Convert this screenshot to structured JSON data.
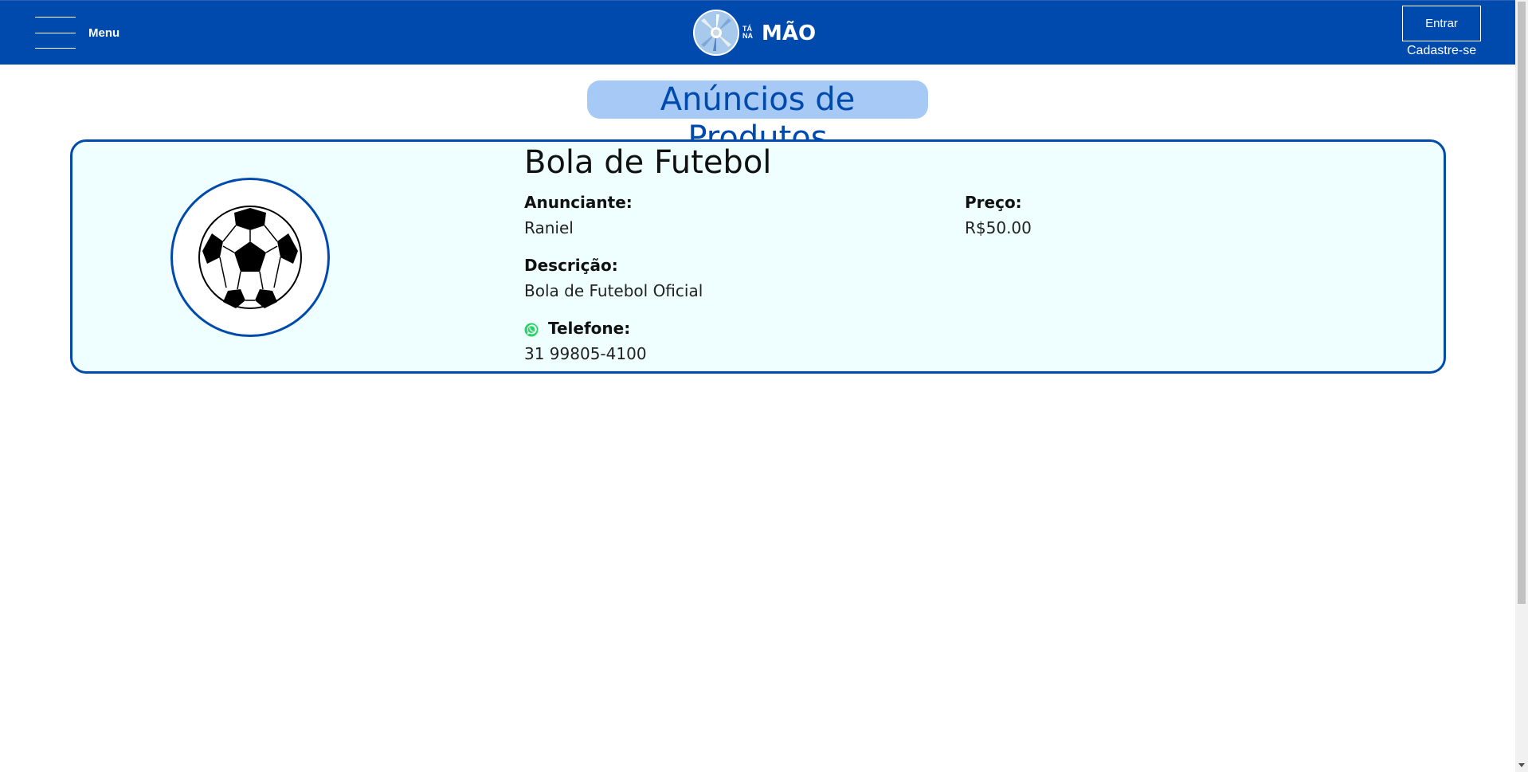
{
  "header": {
    "menu_label": "Menu",
    "logo": {
      "small_top": "TÁ",
      "small_bottom": "NA",
      "big": "MÃO"
    },
    "login_button": "Entrar",
    "signup_link": "Cadastre-se"
  },
  "main": {
    "title": "Anúncios de Produtos",
    "product": {
      "name": "Bola de Futebol",
      "advertiser_label": "Anunciante:",
      "advertiser": "Raniel",
      "price_label": "Preço:",
      "price": "R$50.00",
      "description_label": "Descrição:",
      "description": "Bola de Futebol Oficial",
      "phone_label": "Telefone:",
      "phone": "31 99805-4100",
      "image_icon": "soccer-ball-icon",
      "phone_icon": "whatsapp-icon"
    }
  },
  "colors": {
    "header_bg": "#004aad",
    "title_bg": "#a6c9f5",
    "title_text": "#004aad",
    "card_bg": "#efffff",
    "card_border": "#004aad",
    "whatsapp": "#25d366"
  }
}
